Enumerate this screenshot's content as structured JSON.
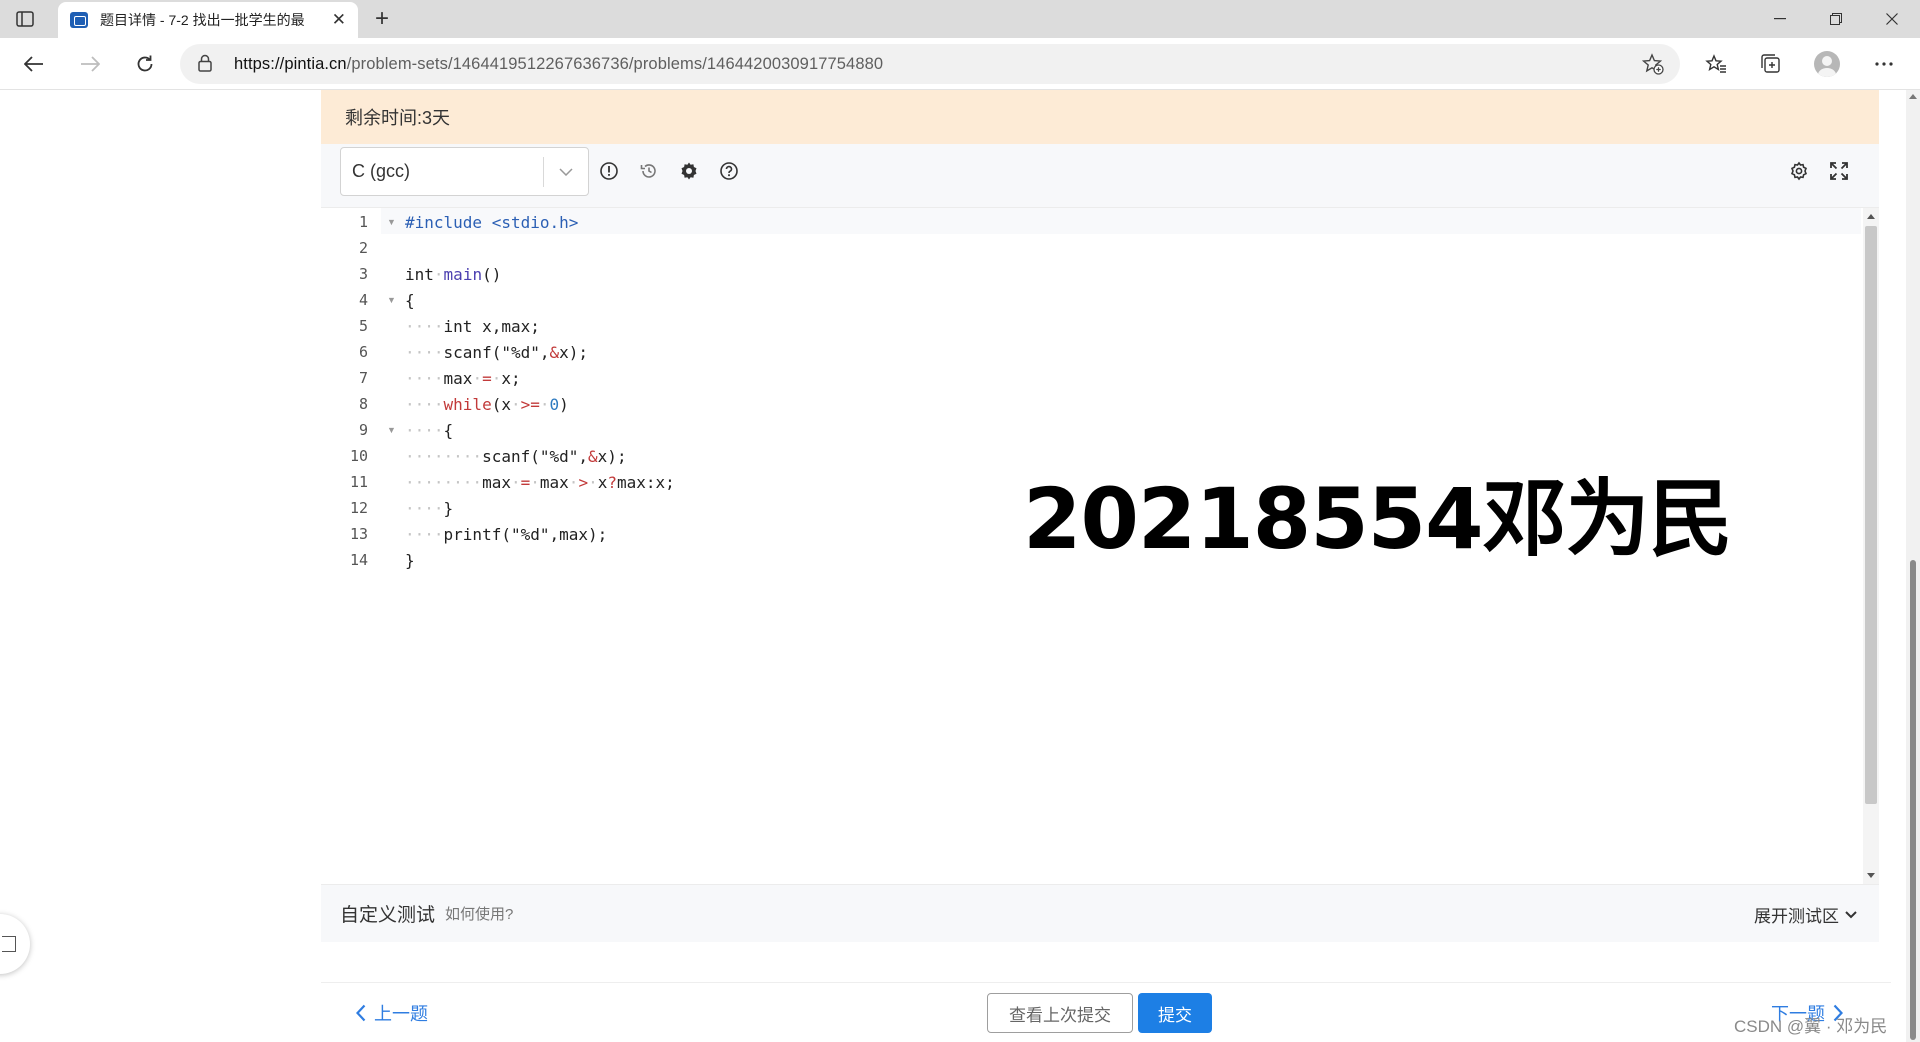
{
  "browser": {
    "tab_title": "题目详情 - 7-2 找出一批学生的最",
    "url_host": "https://pintia.cn",
    "url_path": "/problem-sets/1464419512267636736/problems/1464420030917754880"
  },
  "page": {
    "timer_text": "剩余时间:3天",
    "language": "C (gcc)",
    "code_lines": [
      "1",
      "2",
      "3",
      "4",
      "5",
      "6",
      "7",
      "8",
      "9",
      "10",
      "11",
      "12",
      "13",
      "14"
    ],
    "code": {
      "l1": "#include <stdio.h>",
      "l3_type": "int",
      "l3_fn": "main",
      "l3_rest": "()",
      "l4": "{",
      "l5": "int x,max;",
      "l6_a": "scanf(\"%d\",",
      "l6_amp": "&",
      "l6_b": "x);",
      "l7_a": "max",
      "l7_op": "=",
      "l7_b": "x;",
      "l8_kw": "while",
      "l8_a": "(x",
      "l8_op": ">=",
      "l8_num": "0",
      "l8_b": ")",
      "l9": "{",
      "l10_a": "scanf(\"%d\",",
      "l10_amp": "&",
      "l10_b": "x);",
      "l11_a": "max",
      "l11_op1": "=",
      "l11_b": "max",
      "l11_op2": ">",
      "l11_c": "x",
      "l11_op3": "?",
      "l11_d": "max:x;",
      "l12": "}",
      "l13": "printf(\"%d\",max);",
      "l14": "}"
    },
    "overlay_text": "20218554邓为民",
    "custom_test_title": "自定义测试",
    "custom_test_help": "如何使用?",
    "expand_test_label": "展开测试区",
    "prev_label": "上一题",
    "next_label": "下一题",
    "view_last_submission": "查看上次提交",
    "submit_label": "提交",
    "csdn_watermark": "CSDN @翼 · 邓为民"
  },
  "colors": {
    "timer_bg": "#fdebd6",
    "accent_blue": "#1d7fe5",
    "link_blue": "#2f7de1"
  }
}
